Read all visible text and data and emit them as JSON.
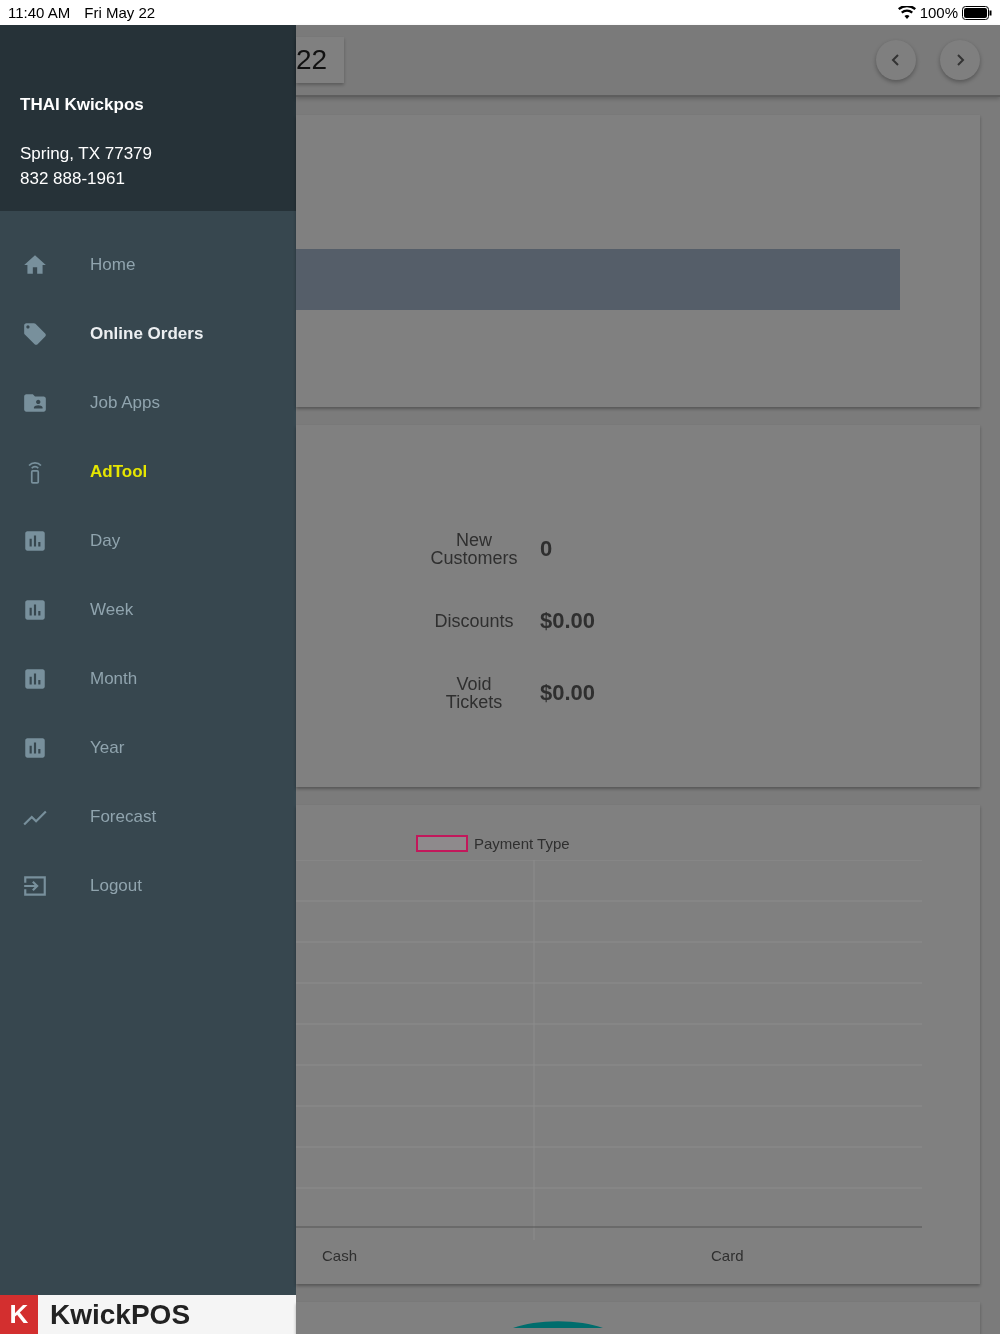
{
  "status_bar": {
    "time": "11:40 AM",
    "date": "Fri May 22",
    "battery": "100%"
  },
  "drawer": {
    "store_name": "THAI Kwickpos",
    "address": "Spring, TX 77379",
    "phone": "832 888-1961",
    "items": [
      {
        "label": "Home",
        "kind": "home",
        "selected": false,
        "highlighted": false
      },
      {
        "label": "Online Orders",
        "kind": "tag",
        "selected": false,
        "highlighted": true
      },
      {
        "label": "Job Apps",
        "kind": "folder",
        "selected": false,
        "highlighted": false
      },
      {
        "label": "AdTool",
        "kind": "remote",
        "selected": true,
        "highlighted": false
      },
      {
        "label": "Day",
        "kind": "bars",
        "selected": false,
        "highlighted": false
      },
      {
        "label": "Week",
        "kind": "bars",
        "selected": false,
        "highlighted": false
      },
      {
        "label": "Month",
        "kind": "bars",
        "selected": false,
        "highlighted": false
      },
      {
        "label": "Year",
        "kind": "bars",
        "selected": false,
        "highlighted": false
      },
      {
        "label": "Forecast",
        "kind": "trend",
        "selected": false,
        "highlighted": false
      },
      {
        "label": "Logout",
        "kind": "logout",
        "selected": false,
        "highlighted": false
      }
    ],
    "logo": {
      "mark": "K",
      "text": "KwickPOS"
    }
  },
  "header": {
    "title": "22"
  },
  "stats": [
    {
      "label": "New Customers",
      "value": "0"
    },
    {
      "label": "Discounts",
      "value": "$0.00"
    },
    {
      "label": "Void Tickets",
      "value": "$0.00"
    }
  ],
  "chart": {
    "legend": "Payment Type",
    "categories": [
      "Cash",
      "Card"
    ]
  }
}
